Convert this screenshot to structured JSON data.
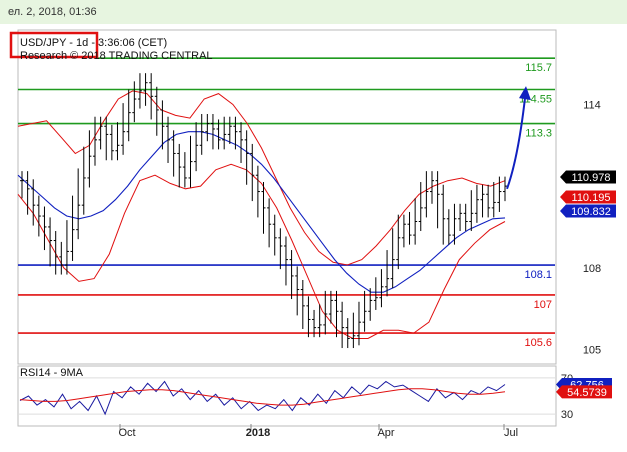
{
  "timestamp": "ел. 2, 2018, 01:36",
  "header": {
    "title": "USD/JPY - 1d - 3:36:06 (CET)",
    "subtitle": "Research © 2018 TRADING CENTRAL"
  },
  "rsi_label": "RSI14 - 9MA",
  "colors": {
    "green": "#1f9a1f",
    "blue": "#1020c0",
    "red": "#e01010",
    "price": "#000000",
    "rsi": "#1a1aa0"
  },
  "chart_data": [
    {
      "type": "line",
      "title": "USD/JPY - 1d",
      "y_ticks": [
        105,
        108,
        114
      ],
      "x_labels": [
        "Oct",
        "2018",
        "Apr",
        "Jul"
      ],
      "ylim": [
        104.5,
        116.7
      ],
      "levels": [
        {
          "value": 115.7,
          "label": "115.7",
          "color": "#1f9a1f"
        },
        {
          "value": 114.55,
          "label": "114.55",
          "color": "#1f9a1f"
        },
        {
          "value": 113.3,
          "label": "113.3",
          "color": "#1f9a1f"
        },
        {
          "value": 108.1,
          "label": "108.1",
          "color": "#1020c0"
        },
        {
          "value": 107,
          "label": "107",
          "color": "#e01010"
        },
        {
          "value": 105.6,
          "label": "105.6",
          "color": "#e01010"
        }
      ],
      "price_tags": [
        {
          "value": 110.978,
          "label": "110.978",
          "bg": "#000000",
          "fg": "#ffffff"
        },
        {
          "value": 110.195,
          "label": "110.195",
          "bg": "#e01010",
          "fg": "#ffffff"
        },
        {
          "value": 109.832,
          "label": "109.832",
          "bg": "#1020c0",
          "fg": "#ffffff"
        }
      ],
      "series": [
        {
          "values": [
            111.2,
            110.9,
            110.3,
            109.9,
            109.5,
            109.0,
            108.4,
            108.1,
            108.6,
            109.4,
            110.3,
            111.3,
            112.1,
            112.7,
            113.2,
            112.9,
            112.3,
            112.5,
            113.0,
            113.7,
            114.2,
            114.5,
            114.8,
            114.3,
            113.8,
            113.2,
            112.7,
            112.2,
            111.7,
            111.3,
            111.9,
            112.5,
            113.0,
            113.3,
            113.1,
            112.7,
            112.9,
            113.2,
            113.0,
            112.7,
            112.2,
            111.4,
            110.8,
            110.2,
            109.6,
            109.1,
            108.8,
            108.3,
            107.7,
            107.2,
            106.6,
            106.1,
            105.8,
            105.9,
            106.3,
            106.8,
            106.4,
            105.8,
            105.4,
            105.5,
            106.0,
            106.4,
            106.8,
            106.9,
            107.3,
            107.6,
            108.3,
            109.1,
            109.6,
            109.2,
            109.7,
            110.2,
            110.8,
            111.2,
            110.7,
            109.8,
            109.2,
            109.8,
            110.0,
            109.7,
            110.0,
            110.5,
            110.7,
            110.2,
            110.4,
            110.8,
            111.0
          ]
        },
        {
          "name": "MA",
          "values": [
            111.4,
            111.0,
            110.6,
            110.2,
            109.9,
            109.8,
            109.9,
            110.1,
            110.5,
            111.0,
            111.6,
            112.1,
            112.6,
            112.9,
            113.0,
            113.0,
            112.9,
            112.7,
            112.5,
            112.2,
            111.8,
            111.3,
            110.7,
            110.1,
            109.5,
            108.9,
            108.3,
            107.8,
            107.4,
            107.1,
            107.1,
            107.3,
            107.6,
            107.9,
            108.3,
            108.7,
            109.1,
            109.4,
            109.6,
            109.8,
            109.832
          ]
        },
        {
          "name": "BB Upper",
          "values": [
            113.2,
            113.3,
            113.4,
            112.8,
            112.2,
            112.5,
            113.4,
            114.2,
            114.5,
            114.4,
            113.8,
            113.6,
            113.5,
            114.2,
            114.4,
            114.0,
            113.3,
            112.4,
            111.3,
            110.2,
            109.3,
            108.6,
            108.2,
            108.1,
            108.3,
            108.8,
            109.4,
            110.1,
            110.7,
            111.0,
            111.2,
            111.3,
            111.1,
            111.0,
            111.2
          ]
        },
        {
          "name": "BB Lower",
          "values": [
            110.7,
            110.0,
            109.0,
            108.0,
            107.5,
            107.6,
            108.5,
            110.0,
            111.2,
            111.4,
            111.1,
            110.9,
            111.0,
            111.6,
            111.8,
            111.6,
            111.1,
            110.2,
            109.0,
            107.7,
            106.4,
            105.7,
            105.4,
            105.4,
            105.7,
            105.7,
            105.6,
            106.0,
            107.2,
            108.3,
            108.9,
            109.4,
            109.7
          ]
        }
      ]
    },
    {
      "type": "line",
      "title": "RSI14 - 9MA",
      "y_ticks": [
        30,
        70
      ],
      "ylim": [
        18,
        82
      ],
      "price_tags": [
        {
          "value": 62.756,
          "label": "62.756",
          "bg": "#1020c0",
          "fg": "#ffffff"
        },
        {
          "value": 54.573,
          "label": "54.5739",
          "bg": "#e01010",
          "fg": "#ffffff"
        }
      ],
      "series": [
        {
          "name": "RSI14",
          "values": [
            45,
            50,
            40,
            46,
            38,
            52,
            36,
            44,
            34,
            50,
            30,
            55,
            48,
            60,
            52,
            64,
            55,
            66,
            50,
            58,
            46,
            56,
            44,
            52,
            40,
            48,
            36,
            44,
            34,
            40,
            36,
            46,
            34,
            48,
            40,
            52,
            42,
            56,
            48,
            60,
            52,
            62,
            58,
            66,
            60,
            62,
            56,
            50,
            44,
            58,
            48,
            54,
            46,
            56,
            52,
            60,
            56,
            62.7
          ]
        },
        {
          "name": "MA9",
          "values": [
            46,
            45,
            44,
            44,
            45,
            47,
            49,
            51,
            53,
            55,
            56,
            57,
            57,
            56,
            54,
            52,
            50,
            48,
            46,
            44,
            42,
            41,
            40,
            40,
            41,
            43,
            45,
            47,
            49,
            51,
            53,
            55,
            57,
            58,
            58,
            57,
            55,
            53,
            52,
            52,
            53,
            54.6
          ]
        }
      ]
    }
  ]
}
